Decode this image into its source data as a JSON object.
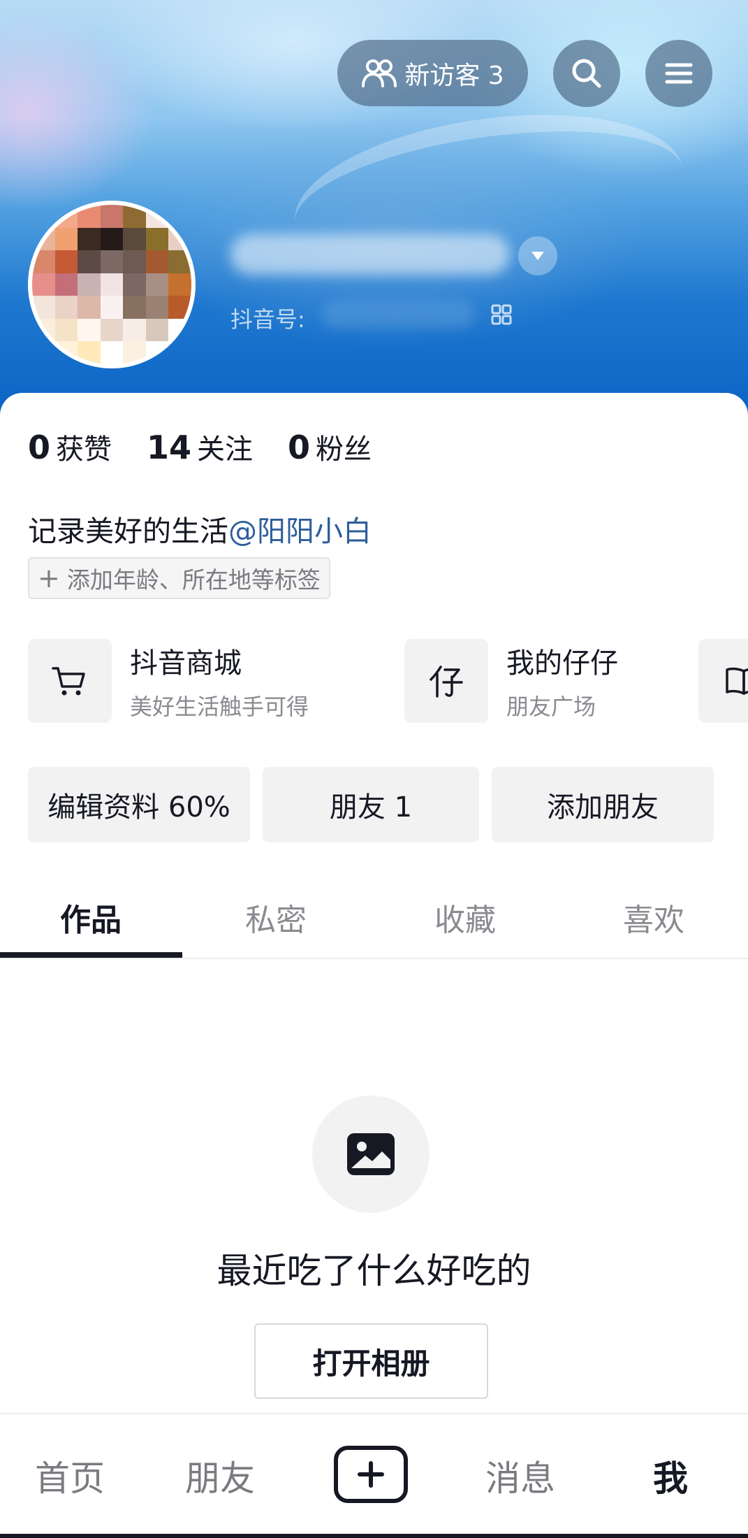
{
  "header": {
    "visitor_button": {
      "label": "新访客 3",
      "icon": "people-icon"
    },
    "search_icon": "search-icon",
    "menu_icon": "hamburger-menu-icon",
    "douyin_id_label": "抖音号:",
    "avatar_colors": [
      "#fbe9e6",
      "#f2a98c",
      "#e98a72",
      "#c9776a",
      "#8f6a32",
      "#f3e6df",
      "#ffffff",
      "#e9b49a",
      "#f1a06f",
      "#3b2a22",
      "#241b19",
      "#5a4a3b",
      "#8a6f2c",
      "#e7cfc4",
      "#d9876a",
      "#c65a35",
      "#5c4a44",
      "#7d6863",
      "#6e5a52",
      "#a45a30",
      "#8b6d31",
      "#e68f8a",
      "#c46e78",
      "#c8b3b2",
      "#f2e4e4",
      "#7b6763",
      "#a78f84",
      "#c5702e",
      "#f2e5dc",
      "#ead2c6",
      "#ddb8a8",
      "#fcf1f2",
      "#87705f",
      "#9b8172",
      "#b95a2a",
      "#fbeedb",
      "#f5e3c8",
      "#fff7f0",
      "#e7d6c9",
      "#f7ede6",
      "#d8c8bc",
      "#ffffff",
      "#ffffff",
      "#fff2d8",
      "#ffe9b9",
      "#ffffff",
      "#fbf0df",
      "#ffffff",
      "#ffffff"
    ]
  },
  "stats": [
    {
      "value": "0",
      "label": "获赞"
    },
    {
      "value": "14",
      "label": "关注"
    },
    {
      "value": "0",
      "label": "粉丝"
    }
  ],
  "bio": {
    "text": "记录美好的生活",
    "mention": "@阳阳小白"
  },
  "tag_button": {
    "plus": "+",
    "label": "添加年龄、所在地等标签"
  },
  "services": [
    {
      "title": "抖音商城",
      "subtitle": "美好生活触手可得",
      "icon": "shopping-cart-icon"
    },
    {
      "title": "我的仔仔",
      "subtitle": "朋友广场",
      "icon": "zaizai-icon"
    },
    {
      "icon": "book-icon"
    }
  ],
  "actions": {
    "edit_profile": "编辑资料 60%",
    "friends": "朋友 1",
    "add_friends": "添加朋友"
  },
  "tabs": [
    {
      "label": "作品",
      "active": true
    },
    {
      "label": "私密",
      "active": false
    },
    {
      "label": "收藏",
      "active": false
    },
    {
      "label": "喜欢",
      "active": false
    }
  ],
  "empty_state": {
    "icon": "image-icon",
    "message": "最近吃了什么好吃的",
    "button_label": "打开相册"
  },
  "bottom_nav": {
    "home": "首页",
    "friends": "朋友",
    "create_icon": "plus-icon",
    "messages": "消息",
    "me": "我"
  },
  "colors": {
    "primary_text": "#161823",
    "secondary_text": "#8a8b90",
    "mention": "#2f5e9a",
    "button_bg": "#f2f2f3",
    "header_blue": "#0a63c4"
  }
}
